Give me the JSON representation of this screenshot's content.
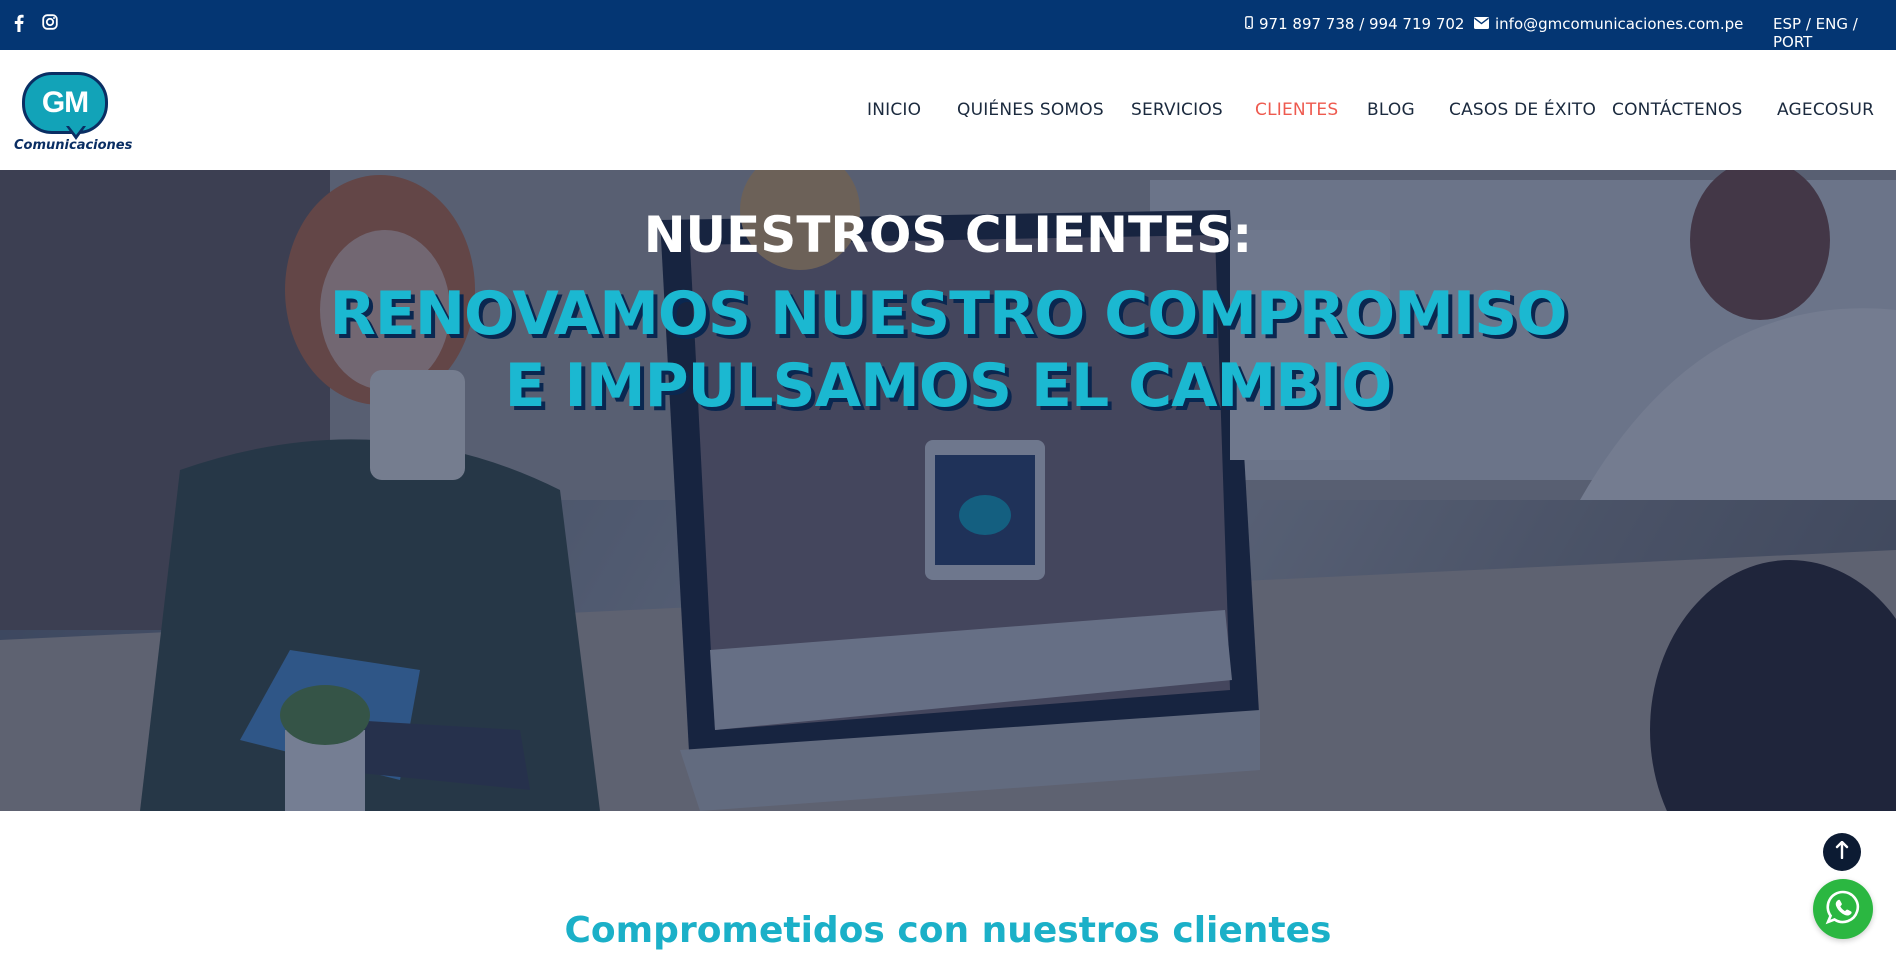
{
  "topbar": {
    "social_icons": [
      "facebook-icon",
      "instagram-icon"
    ],
    "phone": "971 897 738 / 994 719 702",
    "phone_icon": "mobile-phone-icon",
    "email": "info@gmcomunicaciones.com.pe",
    "email_icon": "envelope-icon",
    "languages": "ESP / ENG / PORT",
    "background_color": "#043673"
  },
  "header": {
    "logo": {
      "mark": "GM",
      "brand": "Comunicaciones"
    },
    "nav": [
      {
        "label": "INICIO",
        "active": false
      },
      {
        "label": "QUIÉNES SOMOS",
        "active": false
      },
      {
        "label": "SERVICIOS",
        "active": false
      },
      {
        "label": "CLIENTES",
        "active": true
      },
      {
        "label": "BLOG",
        "active": false
      },
      {
        "label": "CASOS DE ÉXITO",
        "active": false
      },
      {
        "label": "CONTÁCTENOS",
        "active": false
      },
      {
        "label": "AGECOSUR",
        "active": false
      }
    ],
    "active_color": "#ee5a4f"
  },
  "hero": {
    "kicker": "NUESTROS CLIENTES:",
    "headline_line1": "RENOVAMOS NUESTRO COMPROMISO",
    "headline_line2": "E IMPULSAMOS EL CAMBIO",
    "headline_color": "#1bb8d1"
  },
  "section": {
    "title": "Comprometidos con nuestros clientes",
    "title_color": "#1bb0c8"
  },
  "floating": {
    "scroll_top_icon": "arrow-up-icon",
    "whatsapp_icon": "whatsapp-icon",
    "whatsapp_color": "#2bb741"
  }
}
